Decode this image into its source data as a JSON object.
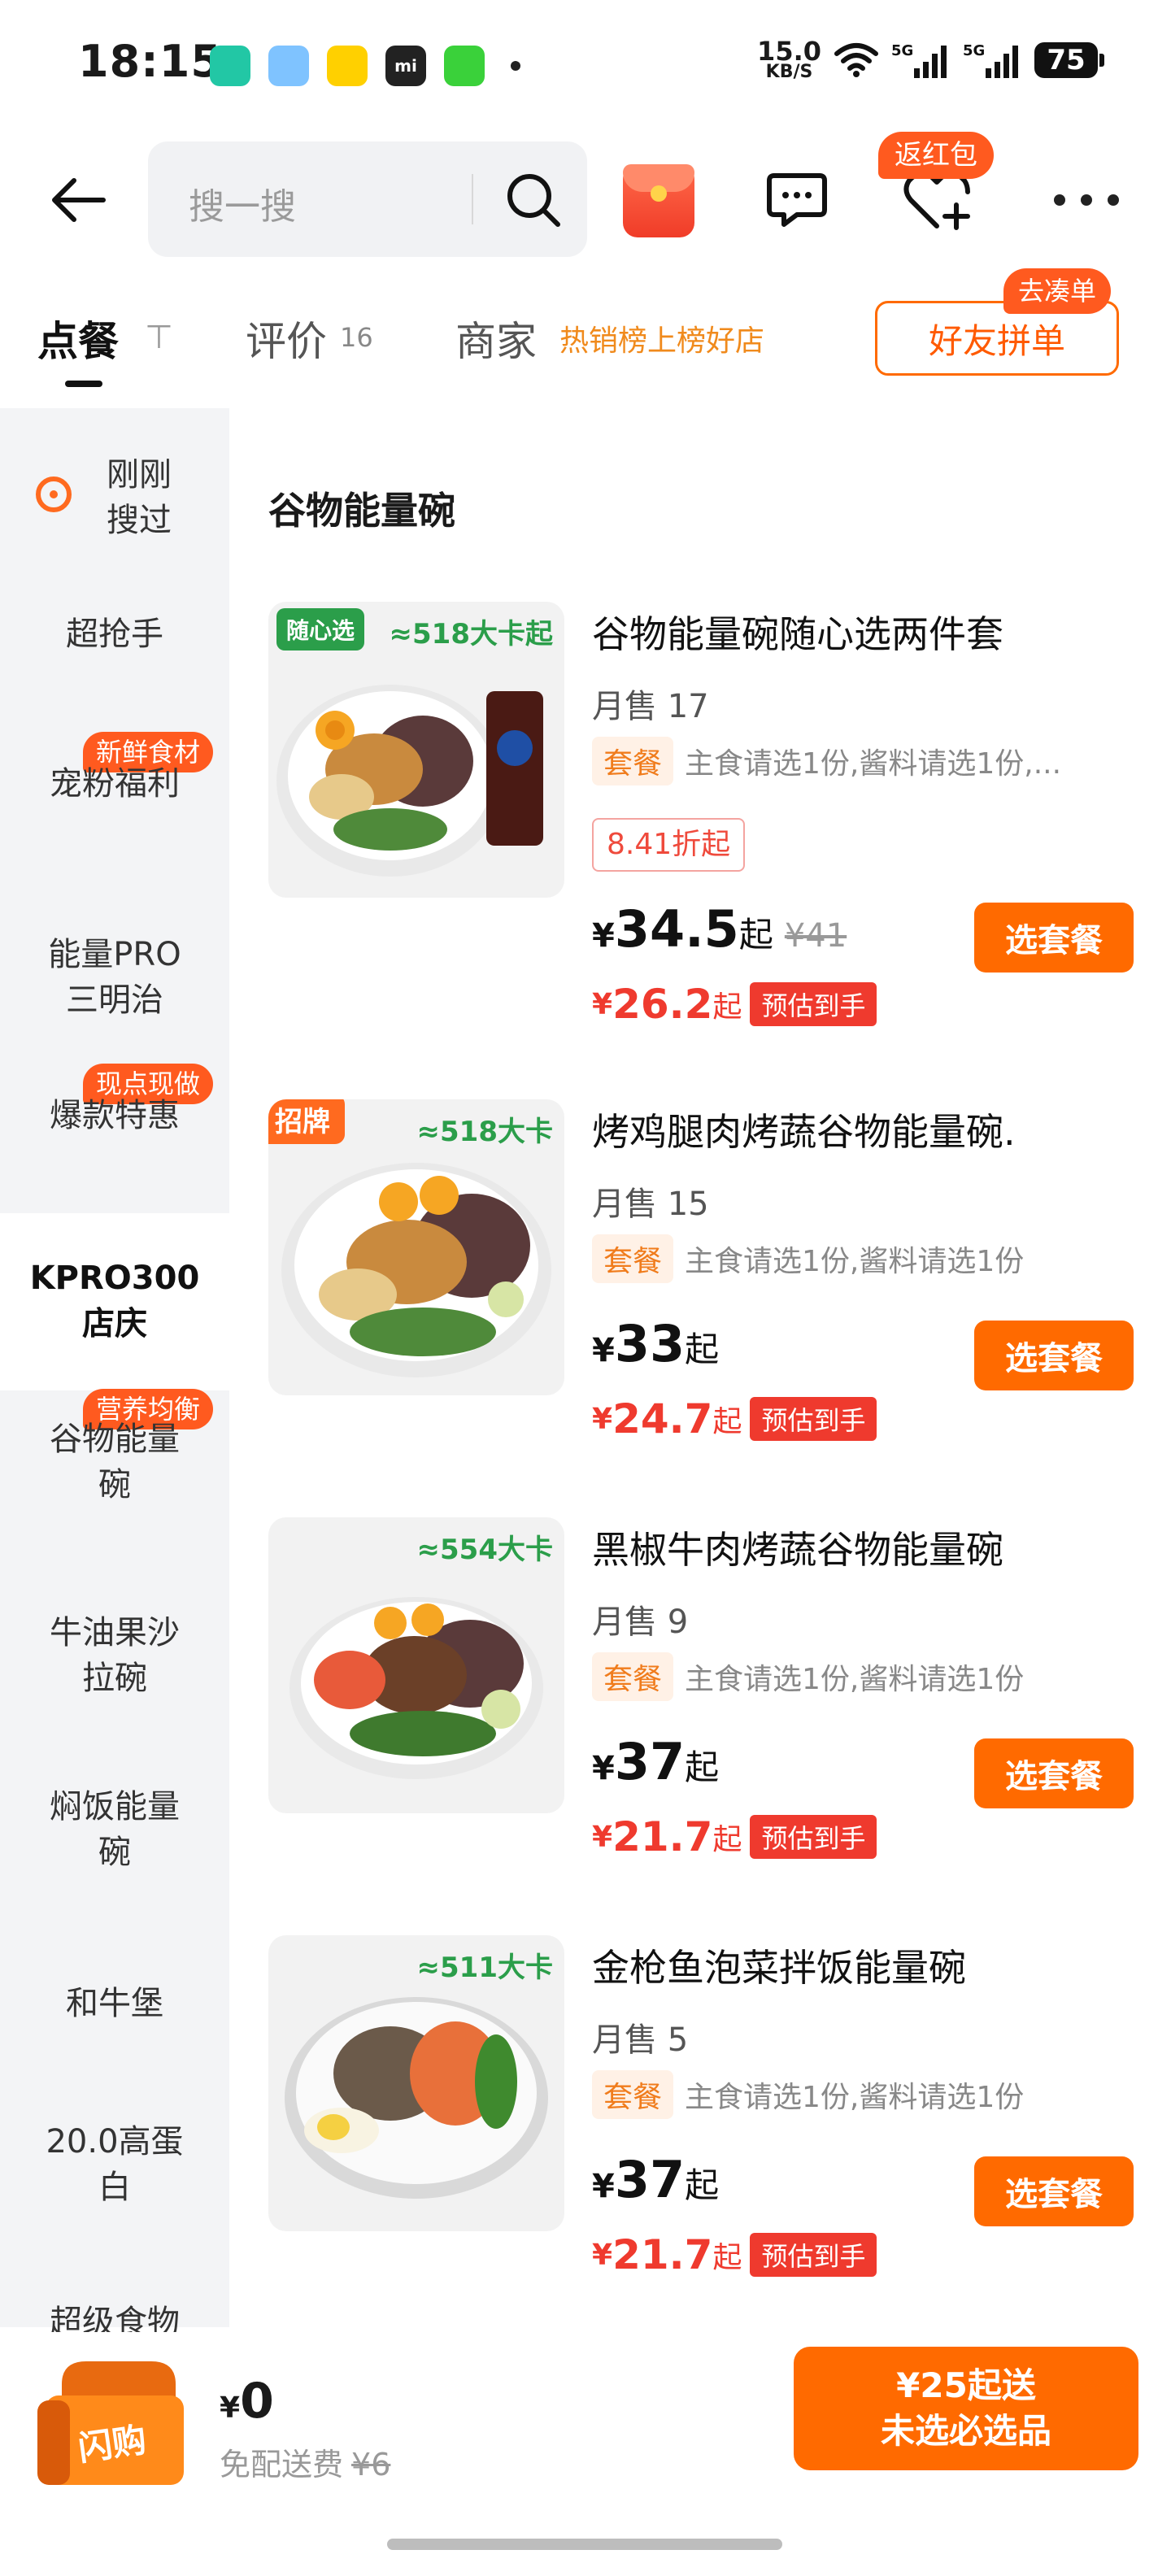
{
  "status_bar": {
    "time": "18:15",
    "net_speed_value": "15.0",
    "net_speed_unit": "KB/S",
    "signal_1": "5G",
    "signal_2": "5G",
    "battery": "75",
    "apps": [
      "app-icon-1",
      "app-icon-2",
      "app-icon-3",
      "app-icon-mi",
      "app-icon-5"
    ]
  },
  "header": {
    "search_placeholder": "搜一搜",
    "fav_badge": "返红包"
  },
  "tabs": {
    "order": "点餐",
    "review": "评价",
    "review_count": "16",
    "merchant": "商家",
    "merchant_hot": "热销榜上榜好店",
    "group_button": "好友拼单",
    "group_badge": "去凑单"
  },
  "sidebar": {
    "items": [
      {
        "label": "刚刚\n搜过"
      },
      {
        "label": "超抢手"
      },
      {
        "label": "宠粉福利",
        "badge": "新鲜食材"
      },
      {
        "label": "能量PRO\n三明治"
      },
      {
        "label": "爆款特惠",
        "badge": "现点现做"
      },
      {
        "label": "KPRO300\n店庆"
      },
      {
        "label": "谷物能量\n碗",
        "badge": "营养均衡"
      },
      {
        "label": "牛油果沙\n拉碗"
      },
      {
        "label": "焖饭能量\n碗"
      },
      {
        "label": "和牛堡"
      },
      {
        "label": "20.0高蛋\n白"
      },
      {
        "label": "超级食物"
      }
    ]
  },
  "section_title": "谷物能量碗",
  "products": [
    {
      "image_tag": "随心选",
      "kcal": "≈518大卡起",
      "name": "谷物能量碗随心选两件套",
      "sales": "月售 17",
      "combo_tag": "套餐",
      "combo_text": "主食请选1份,酱料请选1份,...",
      "discount": "8.41折起",
      "price": "34.5",
      "original_price": "¥41",
      "est_price": "26.2",
      "button": "选套餐"
    },
    {
      "image_tag": "招牌",
      "kcal": "≈518大卡",
      "name": "烤鸡腿肉烤蔬谷物能量碗.",
      "sales": "月售 15",
      "combo_tag": "套餐",
      "combo_text": "主食请选1份,酱料请选1份",
      "price": "33",
      "est_price": "24.7",
      "button": "选套餐"
    },
    {
      "kcal": "≈554大卡",
      "name": "黑椒牛肉烤蔬谷物能量碗",
      "sales": "月售 9",
      "combo_tag": "套餐",
      "combo_text": "主食请选1份,酱料请选1份",
      "price": "37",
      "est_price": "21.7",
      "button": "选套餐"
    },
    {
      "kcal": "≈511大卡",
      "name": "金枪鱼泡菜拌饭能量碗",
      "sales": "月售 5",
      "combo_tag": "套餐",
      "combo_text": "主食请选1份,酱料请选1份",
      "price": "37",
      "est_price": "21.7",
      "button": "选套餐"
    }
  ],
  "labels": {
    "yen": "¥",
    "qi": "起",
    "est_badge": "预估到手"
  },
  "bottom_bar": {
    "bag_label": "闪购",
    "amount": "0",
    "free_delivery": "免配送费",
    "delivery_fee": "¥6",
    "checkout_line1": "¥25起送",
    "checkout_line2": "未选必选品"
  },
  "colors": {
    "accent": "#ff6a00",
    "price_red": "#ef3a2e",
    "kcal_green": "#2b9e4a"
  }
}
